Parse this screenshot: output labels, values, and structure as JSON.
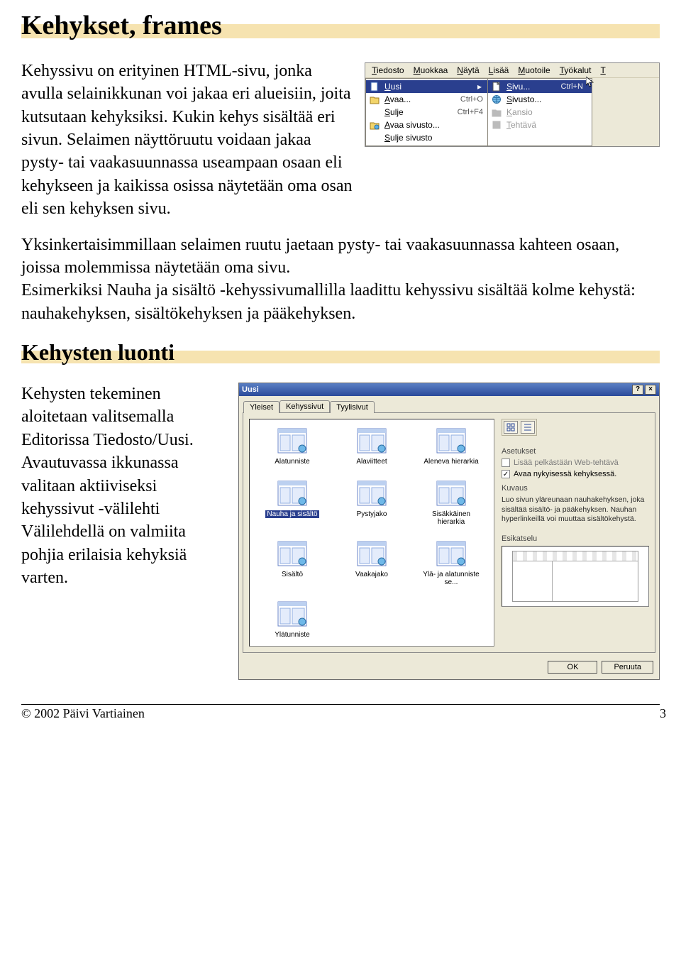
{
  "headings": {
    "h1": "Kehykset, frames",
    "h2": "Kehysten luonti"
  },
  "paragraphs": {
    "p1": "Kehyssivu on erityinen HTML-sivu, jonka avulla selainikkunan voi jakaa eri alueisiin, joita kutsutaan kehyksiksi. Kukin kehys sisältää eri sivun. Selaimen näyttöruutu voidaan jakaa pysty- tai vaakasuunnassa useampaan osaan eli kehykseen ja kaikissa osissa näytetään oma osan eli sen kehyksen sivu.",
    "p2": "Yksinkertaisimmillaan selaimen ruutu jaetaan pysty- tai vaakasuunnassa kahteen osaan, joissa molemmissa näytetään oma sivu.\nEsimerkiksi Nauha ja sisältö -kehyssivumallilla laadittu kehyssivu sisältää kolme kehystä: nauhakehyksen, sisältökehyksen ja pääkehyksen.",
    "p3": "Kehysten tekeminen aloitetaan valitsemalla Editorissa Tiedosto/Uusi. Avautuvassa ikkunassa valitaan aktiiviseksi kehyssivut -välilehti Välilehdellä on valmiita pohjia erilaisia kehyksiä varten."
  },
  "menubar": {
    "items": [
      "Tiedosto",
      "Muokkaa",
      "Näytä",
      "Lisää",
      "Muotoile",
      "Työkalut",
      "T"
    ],
    "left": [
      {
        "label": "Uusi",
        "shortcut": "",
        "arrow": true,
        "selected": true,
        "icon": "new"
      },
      {
        "label": "Avaa...",
        "shortcut": "Ctrl+O",
        "icon": "open"
      },
      {
        "label": "Sulje",
        "shortcut": "Ctrl+F4",
        "icon": ""
      },
      {
        "label": "Avaa sivusto...",
        "shortcut": "",
        "icon": "folder-web"
      },
      {
        "label": "Sulje sivusto",
        "shortcut": "",
        "icon": ""
      }
    ],
    "right": [
      {
        "label": "Sivu...",
        "shortcut": "Ctrl+N",
        "icon": "page",
        "selected": true
      },
      {
        "label": "Sivusto...",
        "shortcut": "",
        "icon": "globe"
      },
      {
        "label": "Kansio",
        "shortcut": "",
        "icon": "folder",
        "dim": true
      },
      {
        "label": "Tehtävä",
        "shortcut": "",
        "icon": "task",
        "dim": true
      }
    ]
  },
  "dialog": {
    "title": "Uusi",
    "tabs": [
      "Yleiset",
      "Kehyssivut",
      "Tyylisivut"
    ],
    "active_tab": 1,
    "icons": [
      "Alatunniste",
      "Alaviitteet",
      "Aleneva hierarkia",
      "Nauha ja sisältö",
      "Pystyjako",
      "Sisäkkäinen hierarkia",
      "Sisältö",
      "Vaakajako",
      "Ylä- ja alatunniste se...",
      "Ylätunniste"
    ],
    "selected_icon": 3,
    "right": {
      "group_settings": "Asetukset",
      "opt1": "Lisää pelkästään Web-tehtävä",
      "opt2": "Avaa nykyisessä kehyksessä.",
      "group_desc": "Kuvaus",
      "desc": "Luo sivun yläreunaan nauhakehyksen, joka sisältää sisältö- ja pääkehyksen. Nauhan hyperlinkeillä voi muuttaa sisältökehystä.",
      "group_preview": "Esikatselu"
    },
    "buttons": {
      "ok": "OK",
      "cancel": "Peruuta"
    }
  },
  "footer": {
    "copyright": "© 2002 Päivi Vartiainen",
    "page": "3"
  }
}
